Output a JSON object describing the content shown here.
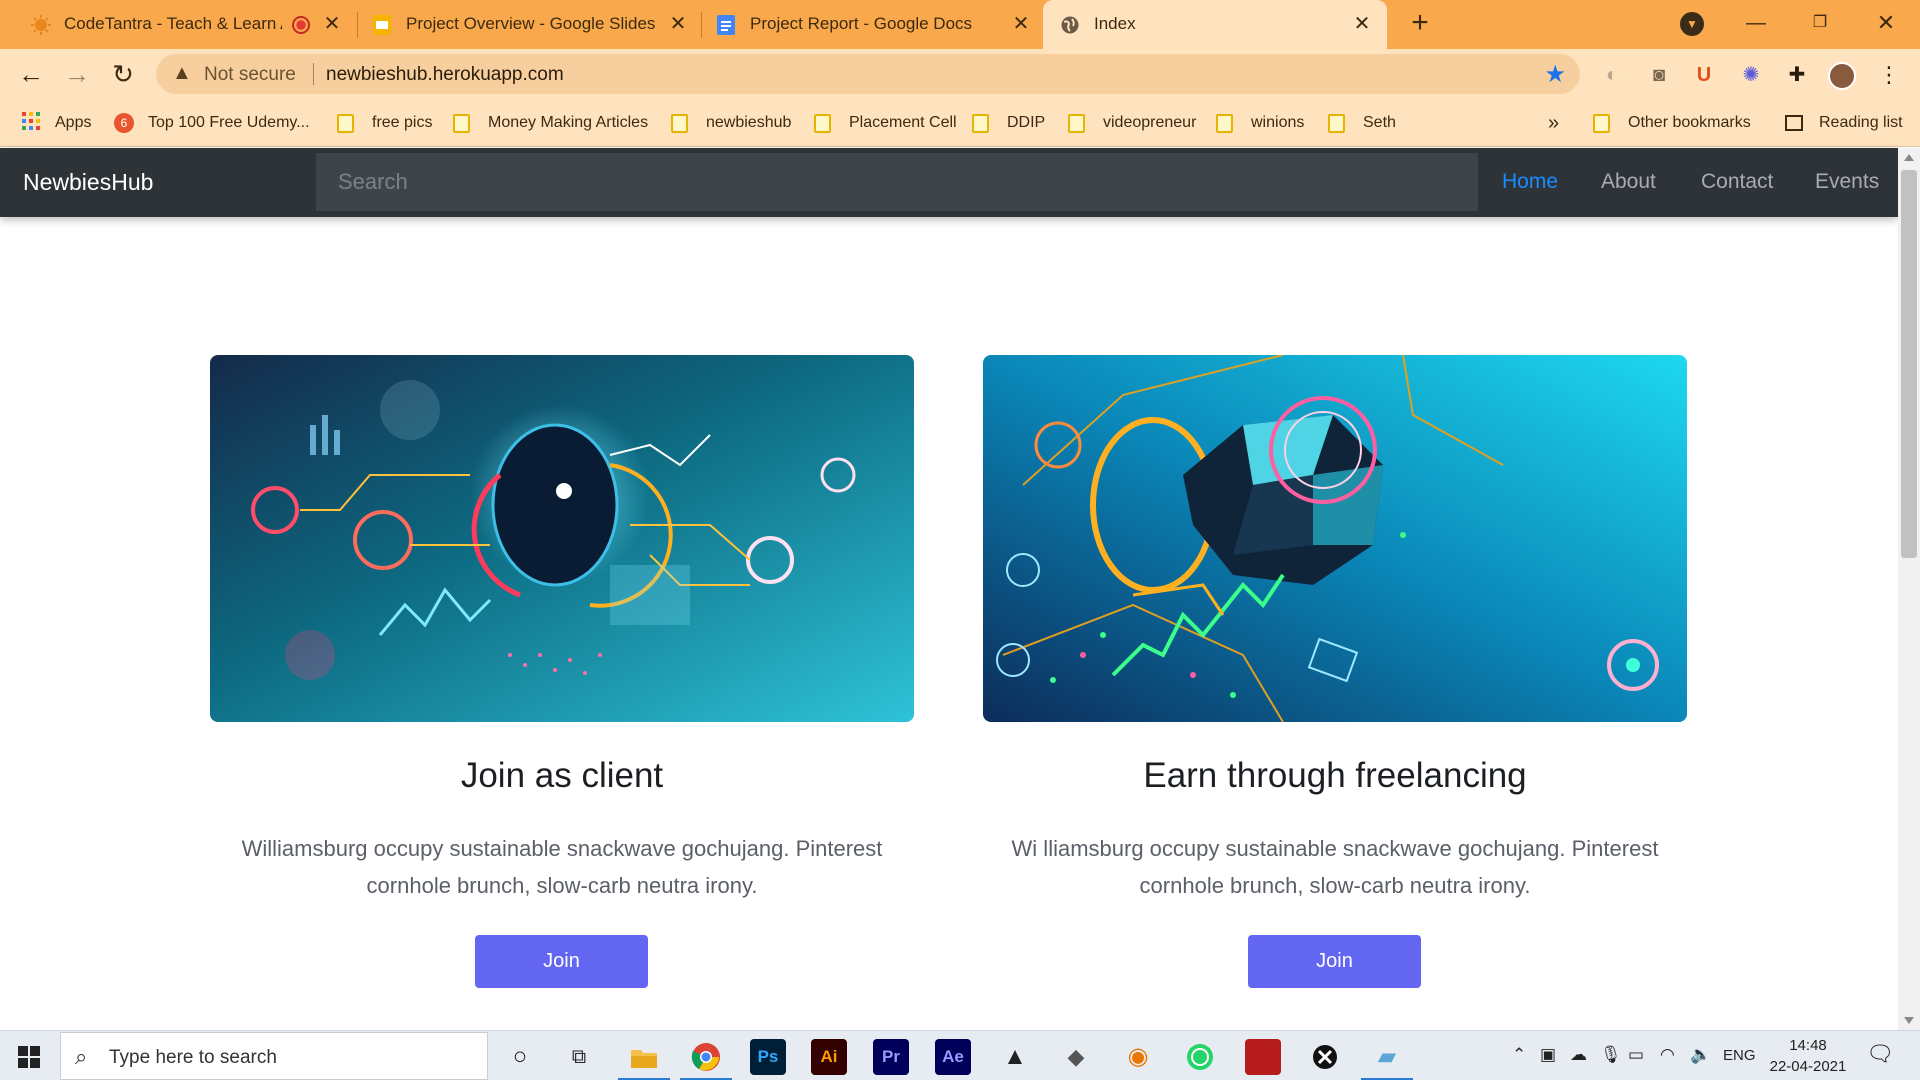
{
  "browser": {
    "tabs": [
      {
        "title": "CodeTantra - Teach & Learn An",
        "favicon": "codetantra-icon",
        "recording": true
      },
      {
        "title": "Project Overview - Google Slides",
        "favicon": "google-slides-icon"
      },
      {
        "title": "Project Report - Google Docs",
        "favicon": "google-docs-icon"
      },
      {
        "title": "Index",
        "favicon": "globe-icon",
        "active": true
      }
    ],
    "address": {
      "security_label": "Not secure",
      "url": "newbieshub.herokuapp.com"
    },
    "bookmarks": [
      {
        "label": "Apps",
        "icon": "apps-grid-icon"
      },
      {
        "label": "Top 100 Free Udemy...",
        "icon": "udemy-icon"
      },
      {
        "label": "free pics",
        "icon": "folder-icon"
      },
      {
        "label": "Money Making Articles",
        "icon": "folder-icon"
      },
      {
        "label": "newbieshub",
        "icon": "folder-icon"
      },
      {
        "label": "Placement Cell",
        "icon": "folder-icon"
      },
      {
        "label": "DDIP",
        "icon": "folder-icon"
      },
      {
        "label": "videopreneur",
        "icon": "folder-icon"
      },
      {
        "label": "winions",
        "icon": "folder-icon"
      },
      {
        "label": "Seth",
        "icon": "folder-icon"
      }
    ],
    "bookmarks_overflow": "»",
    "other_bookmarks": "Other bookmarks",
    "reading_list": "Reading list",
    "colors": {
      "tabstrip": "#f9a94b",
      "toolbar": "#fee3be"
    }
  },
  "site": {
    "brand": "NewbiesHub",
    "search_placeholder": "Search",
    "nav": [
      {
        "label": "Home",
        "active": true
      },
      {
        "label": "About"
      },
      {
        "label": "Contact"
      },
      {
        "label": "Events"
      }
    ],
    "cards": [
      {
        "title": "Join as client",
        "text": "Williamsburg occupy sustainable snackwave gochujang. Pinterest cornhole brunch, slow-carb neutra irony.",
        "button": "Join"
      },
      {
        "title": "Earn through freelancing",
        "text": "Wi lliamsburg occupy sustainable snackwave gochujang. Pinterest cornhole brunch, slow-carb neutra irony.",
        "button": "Join"
      }
    ],
    "colors": {
      "navbar": "#2e3338",
      "active_link": "#1a8cff",
      "button": "#6366f1"
    }
  },
  "taskbar": {
    "search_placeholder": "Type here to search",
    "apps": [
      "cortana-icon",
      "task-view-icon",
      "file-explorer-icon",
      "chrome-icon",
      "photoshop-icon",
      "illustrator-icon",
      "premiere-icon",
      "after-effects-icon",
      "inkscape-icon",
      "gimp-icon",
      "blender-icon",
      "whatsapp-icon",
      "app-icon",
      "xbox-icon",
      "notes-icon"
    ],
    "app_labels": {
      "photoshop": "Ps",
      "illustrator": "Ai",
      "premiere": "Pr",
      "after_effects": "Ae"
    },
    "language": "ENG",
    "time": "14:48",
    "date": "22-04-2021"
  }
}
